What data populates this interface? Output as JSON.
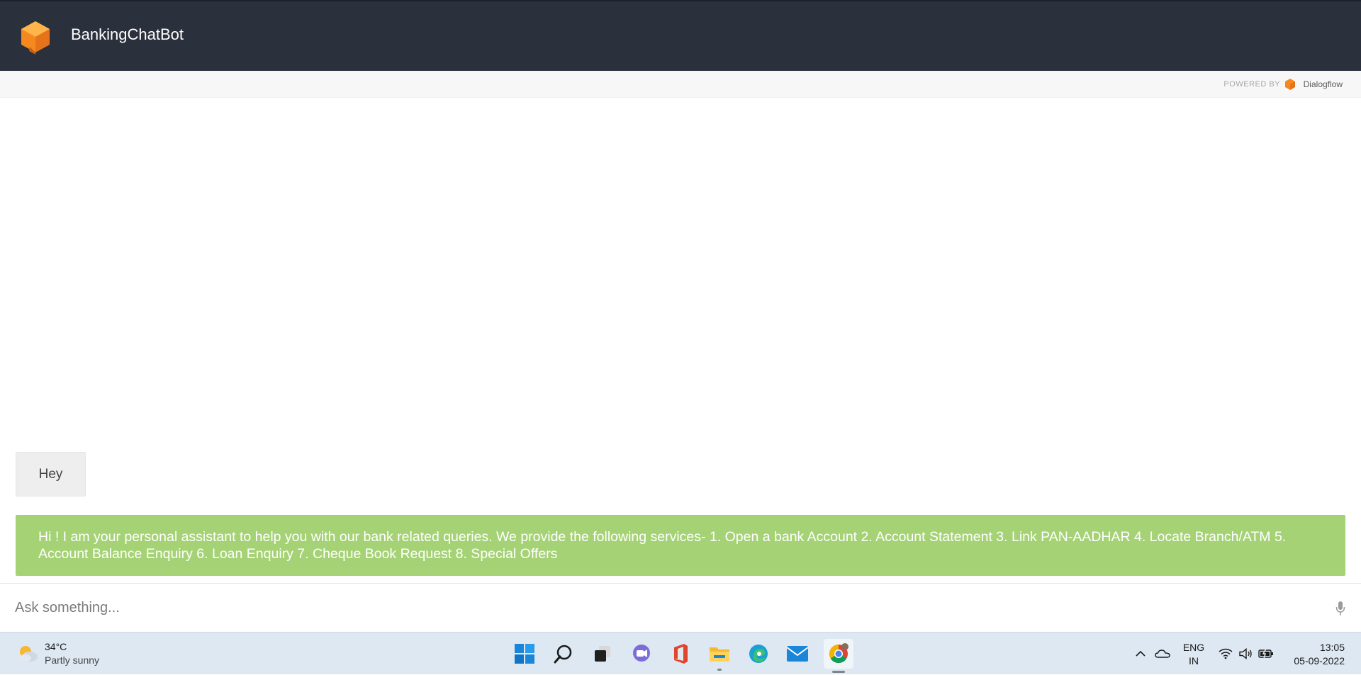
{
  "header": {
    "title": "BankingChatBot"
  },
  "powered": {
    "label": "POWERED BY",
    "brand": "Dialogflow"
  },
  "chat": {
    "messages": [
      {
        "from": "user",
        "text": "Hey"
      },
      {
        "from": "bot",
        "text": "Hi ! I am your personal assistant to help you with our bank related queries. We provide the following services- 1. Open a bank Account 2. Account Statement 3. Link PAN-AADHAR 4. Locate Branch/ATM 5. Account Balance Enquiry 6. Loan Enquiry 7. Cheque Book Request 8. Special Offers"
      }
    ]
  },
  "input": {
    "placeholder": "Ask something...",
    "value": ""
  },
  "taskbar": {
    "weather": {
      "temp": "34°C",
      "desc": "Partly sunny"
    },
    "apps": [
      "start-icon",
      "search-icon",
      "task-view-icon",
      "teams-chat-icon",
      "office-icon",
      "file-explorer-icon",
      "edge-icon",
      "mail-icon",
      "chrome-icon"
    ],
    "language": {
      "line1": "ENG",
      "line2": "IN"
    },
    "clock": {
      "time": "13:05",
      "date": "05-09-2022"
    }
  },
  "colors": {
    "header_bg": "#2b303d",
    "bot_bubble": "#a5d275",
    "user_bubble": "#eeeeee",
    "brand_orange": "#f5891f",
    "taskbar_bg": "#dde8f2"
  }
}
